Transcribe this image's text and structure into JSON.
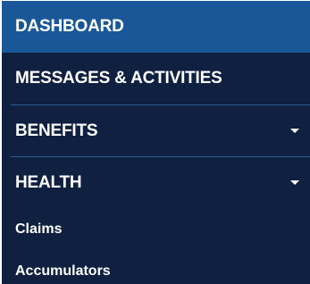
{
  "nav": {
    "items": [
      {
        "label": "DASHBOARD"
      },
      {
        "label": "MESSAGES & ACTIVITIES"
      },
      {
        "label": "BENEFITS",
        "icon": "caret-down-icon"
      },
      {
        "label": "HEALTH",
        "icon": "caret-down-icon",
        "children": [
          {
            "label": "Claims"
          },
          {
            "label": "Accumulators"
          }
        ]
      }
    ]
  },
  "colors": {
    "background": "#0f2040",
    "active": "#1a5799",
    "separator": "#2b5c98",
    "text": "#ffffff"
  }
}
